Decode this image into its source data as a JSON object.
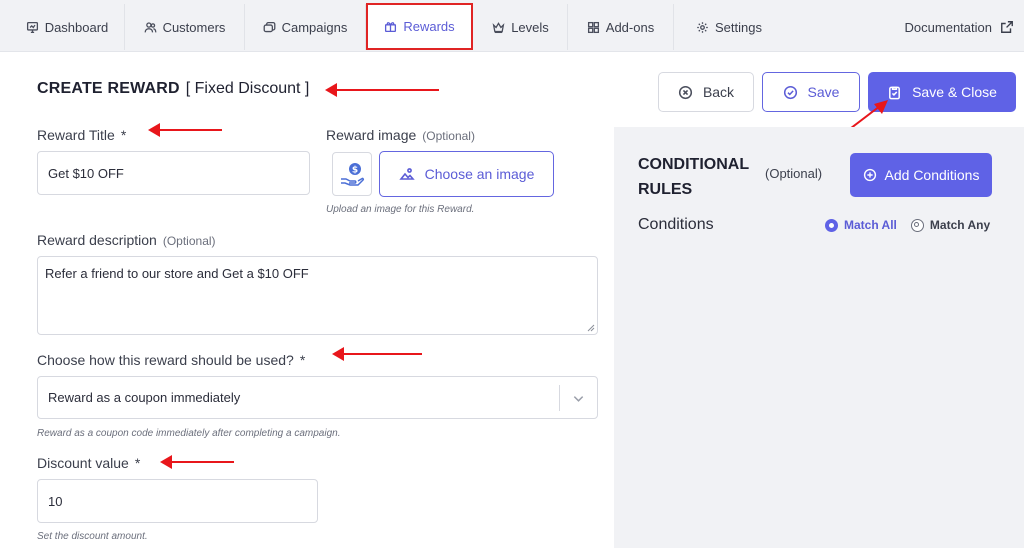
{
  "nav": {
    "tabs": [
      {
        "label": "Dashboard",
        "icon": "dashboard-icon"
      },
      {
        "label": "Customers",
        "icon": "users-icon"
      },
      {
        "label": "Campaigns",
        "icon": "campaigns-icon"
      },
      {
        "label": "Rewards",
        "icon": "gift-icon",
        "active": true
      },
      {
        "label": "Levels",
        "icon": "crown-icon"
      },
      {
        "label": "Add-ons",
        "icon": "grid-icon"
      },
      {
        "label": "Settings",
        "icon": "gear-icon"
      }
    ],
    "documentation": "Documentation"
  },
  "header": {
    "title": "CREATE REWARD",
    "subtitle": "[ Fixed Discount ]"
  },
  "actions": {
    "back": "Back",
    "save": "Save",
    "save_close": "Save & Close"
  },
  "form": {
    "reward_title": {
      "label": "Reward Title",
      "required_mark": "*",
      "value": "Get $10 OFF"
    },
    "reward_image": {
      "label": "Reward image",
      "optional": "(Optional)",
      "button": "Choose an image",
      "help": "Upload an image for this Reward."
    },
    "reward_description": {
      "label": "Reward description",
      "optional": "(Optional)",
      "value": "Refer a friend to our store and Get a $10 OFF"
    },
    "usage": {
      "label": "Choose how this reward should be used?",
      "required_mark": "*",
      "selected": "Reward as a coupon immediately",
      "help": "Reward as a coupon code immediately after completing a campaign."
    },
    "discount": {
      "label": "Discount value",
      "required_mark": "*",
      "value": "10",
      "help": "Set the discount amount."
    }
  },
  "conditions": {
    "title": "CONDITIONAL RULES",
    "optional": "(Optional)",
    "add_button": "Add Conditions",
    "label": "Conditions",
    "match_all": "Match All",
    "match_any": "Match Any",
    "selected": "Match All"
  },
  "colors": {
    "accent": "#5f62e6",
    "annotation_red": "#e8161b",
    "panel_bg": "#f1f2f5"
  }
}
